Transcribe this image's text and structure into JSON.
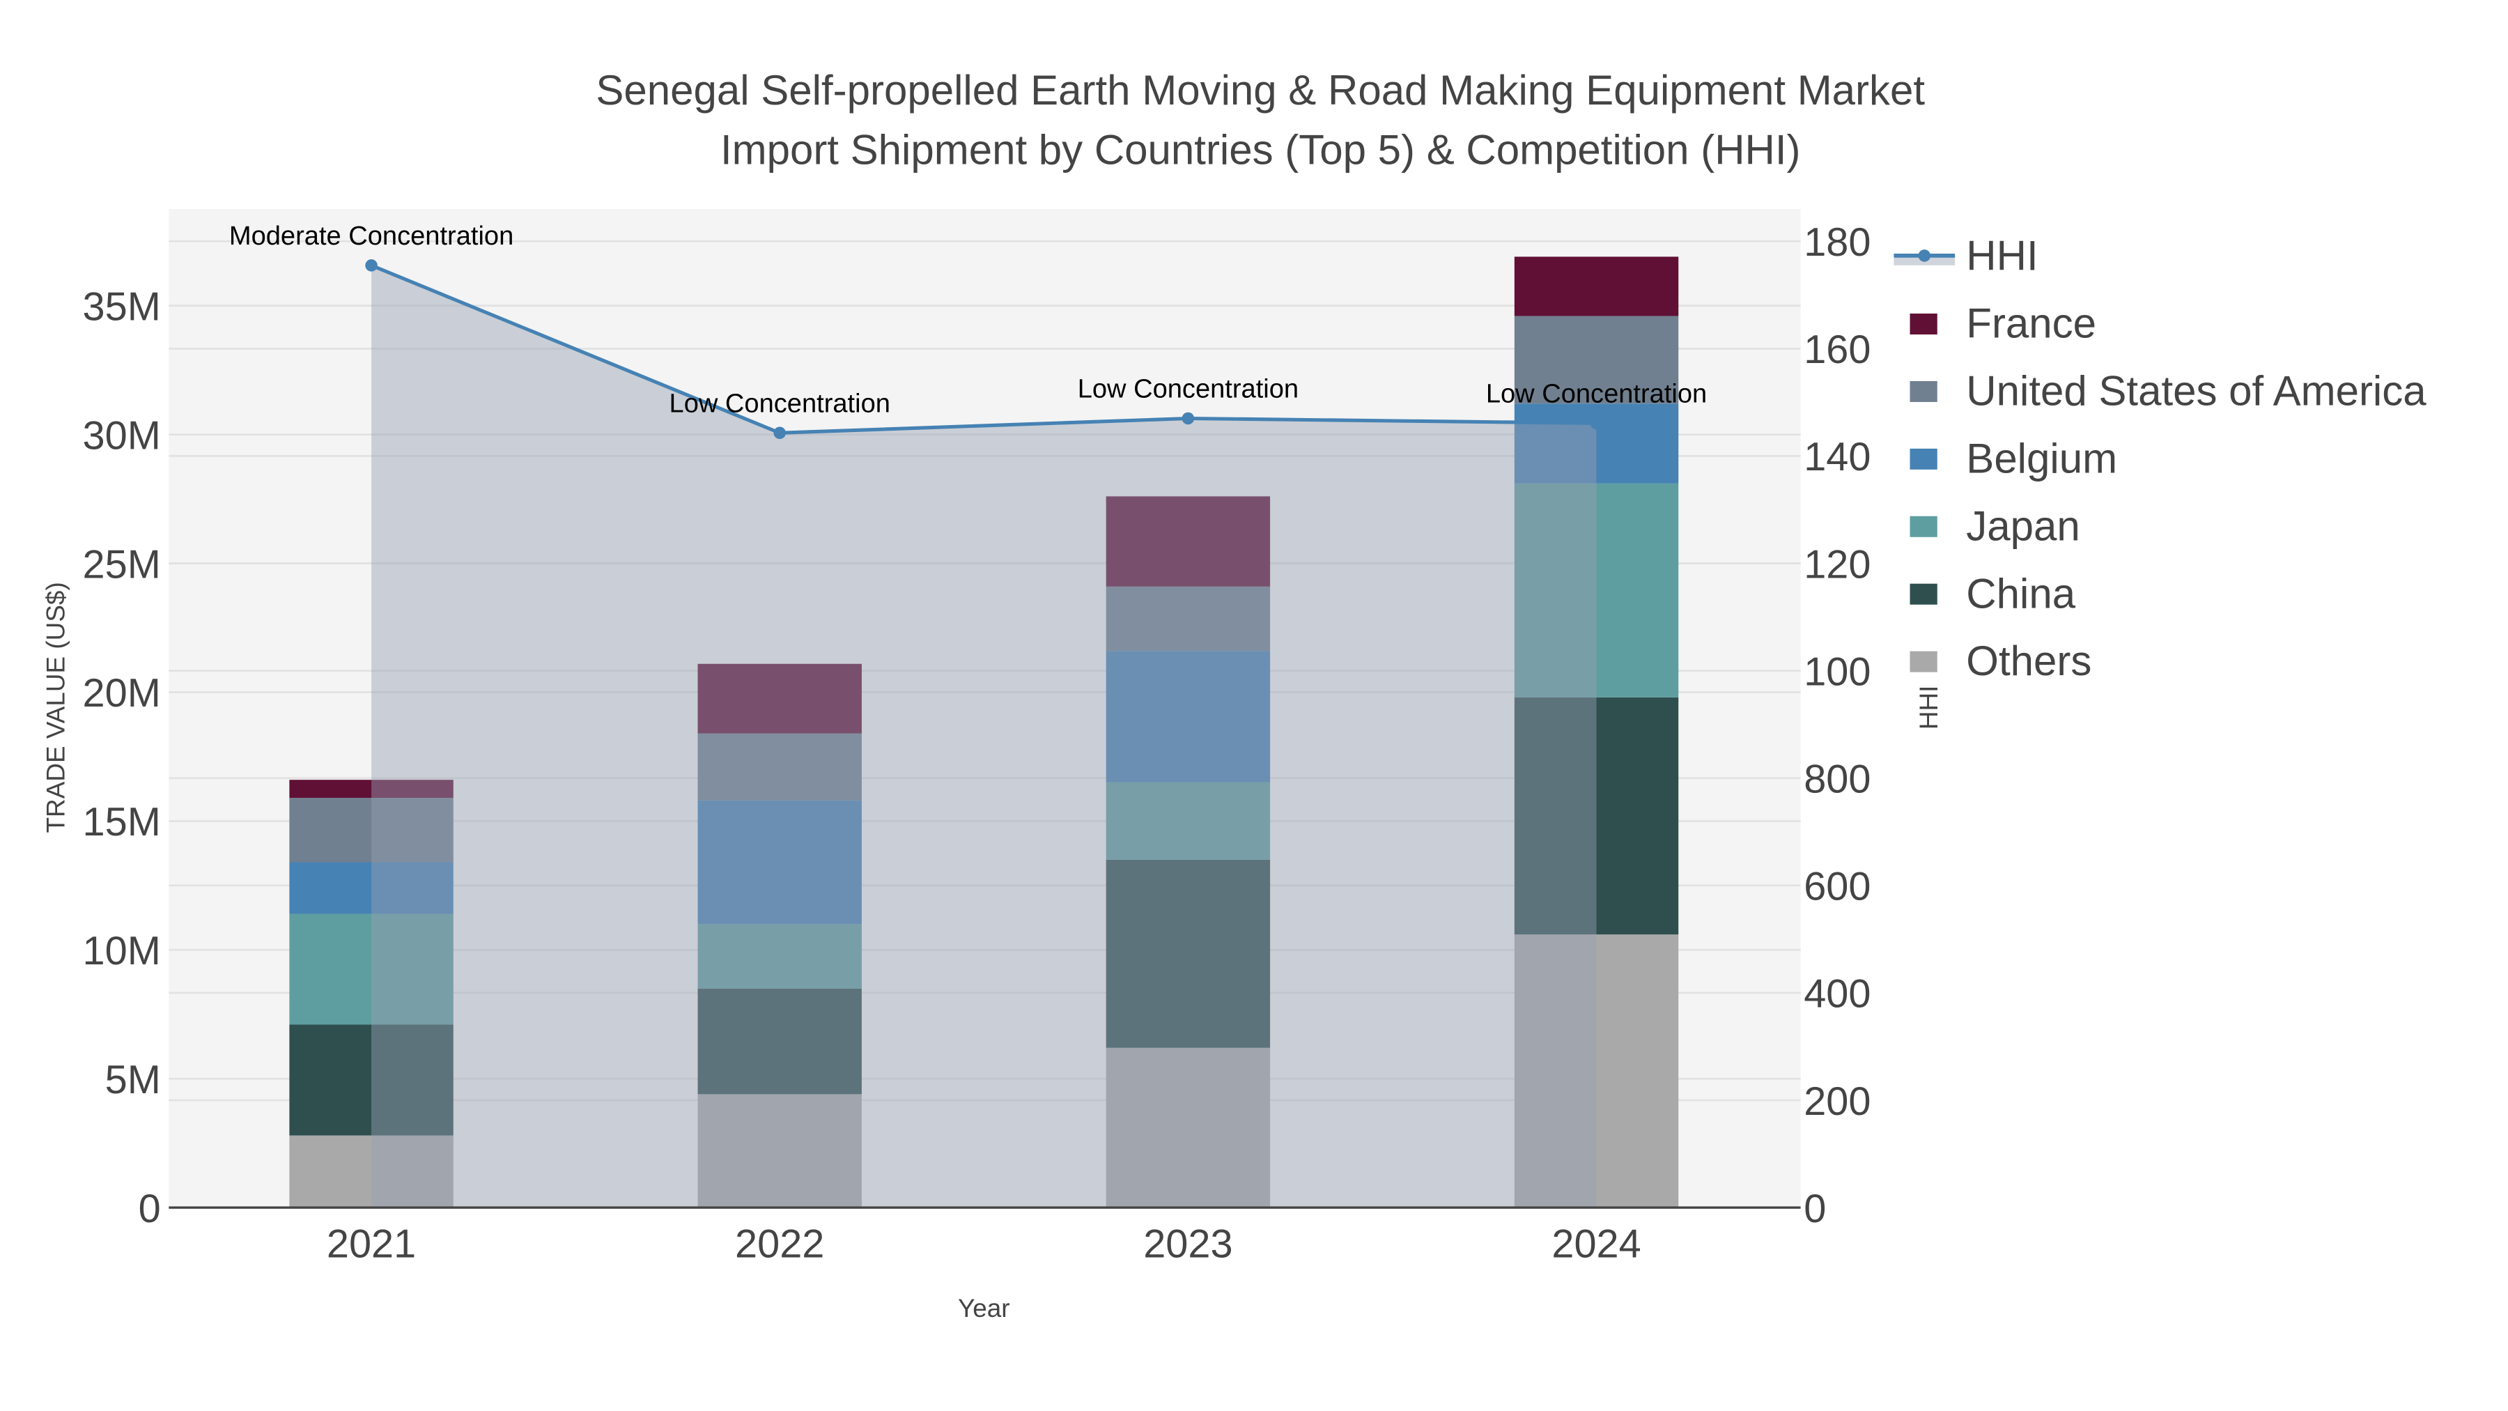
{
  "chart_data": {
    "type": "bar",
    "title_lines": [
      "Senegal Self-propelled Earth Moving & Road Making Equipment Market",
      "Import Shipment by Countries (Top 5) & Competition (HHI)"
    ],
    "xlabel": "Year",
    "ylabel": "TRADE VALUE (US$)",
    "y2label": "HHI",
    "categories": [
      "2021",
      "2022",
      "2023",
      "2024"
    ],
    "ylim": [
      0,
      38.75
    ],
    "y_ticks": [
      0,
      5,
      10,
      15,
      20,
      25,
      30,
      35
    ],
    "y_tick_labels": [
      "0",
      "5M",
      "10M",
      "15M",
      "20M",
      "25M",
      "30M",
      "35M"
    ],
    "y2lim": [
      0,
      1860
    ],
    "y2_ticks": [
      0,
      200,
      400,
      600,
      800,
      1000,
      1200,
      1400,
      1600,
      1800
    ],
    "y2_tick_labels": [
      "0",
      "200",
      "400",
      "600",
      "800",
      "100",
      "120",
      "140",
      "160",
      "180"
    ],
    "stacked": true,
    "units": "million US$",
    "series": [
      {
        "name": "Others",
        "color": "#a9a9a9",
        "values": [
          2.8,
          4.4,
          6.2,
          10.6
        ]
      },
      {
        "name": "China",
        "color": "#2f4f4f",
        "values": [
          4.3,
          4.1,
          7.3,
          9.2
        ]
      },
      {
        "name": "Japan",
        "color": "#5f9ea0",
        "values": [
          4.3,
          2.5,
          3.0,
          8.3
        ]
      },
      {
        "name": "Belgium",
        "color": "#4682b4",
        "values": [
          2.0,
          4.8,
          5.1,
          3.1
        ]
      },
      {
        "name": "United States of America",
        "color": "#708090",
        "values": [
          2.5,
          2.6,
          2.5,
          3.4
        ]
      },
      {
        "name": "France",
        "color": "#601035",
        "values": [
          0.7,
          2.7,
          3.5,
          2.3
        ]
      }
    ],
    "hhi": {
      "name": "HHI",
      "color": "#4682b4",
      "values": [
        1755,
        1443,
        1470,
        1461
      ],
      "annotations": [
        "Moderate Concentration",
        "Low Concentration",
        "Low Concentration",
        "Low Concentration"
      ]
    },
    "legend_order": [
      "HHI",
      "France",
      "United States of America",
      "Belgium",
      "Japan",
      "China",
      "Others"
    ],
    "legend_position": "right",
    "grid": true
  }
}
